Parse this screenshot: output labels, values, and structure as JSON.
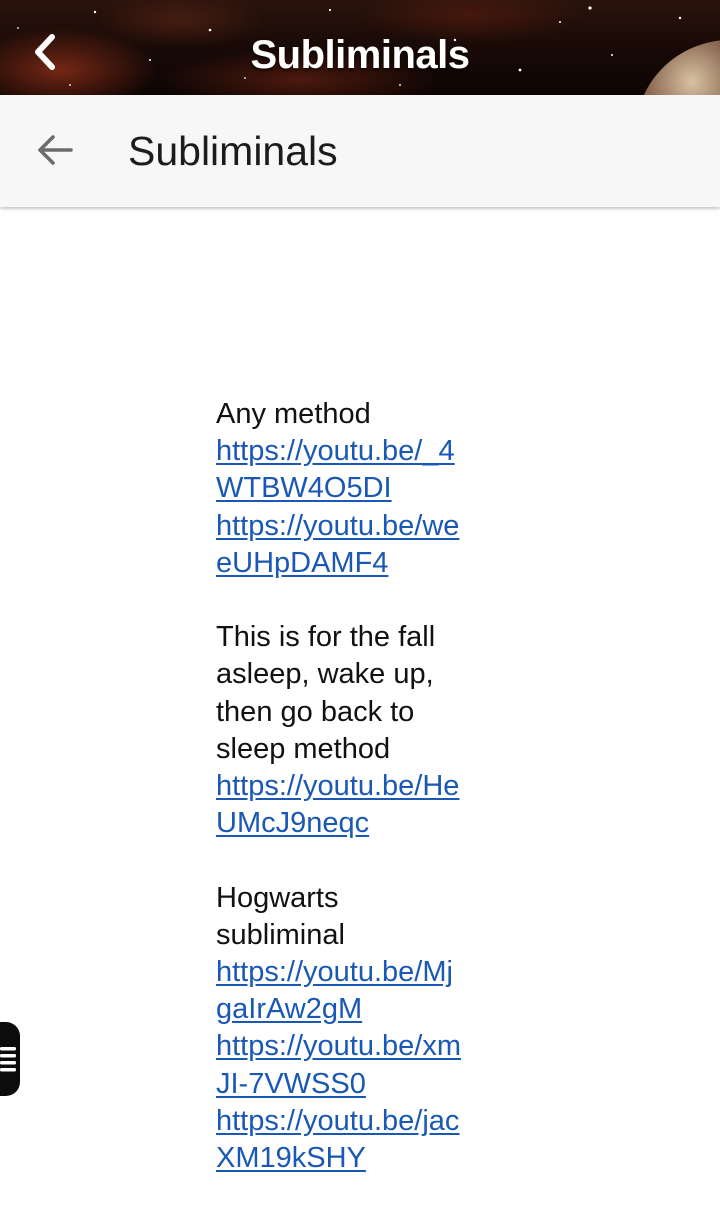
{
  "banner": {
    "title": "Subliminals",
    "back_icon": "chevron-left-icon"
  },
  "appbar": {
    "title": "Subliminals",
    "back_icon": "arrow-left-icon"
  },
  "post": {
    "section_1": {
      "text": "Any method",
      "links": [
        [
          "https://youtu.be/_4",
          "WTBW4O5DI"
        ],
        [
          "https://youtu.be/we",
          "eUHpDAMF4"
        ]
      ]
    },
    "section_2": {
      "text": [
        "This is for the fall",
        "asleep, wake up,",
        "then go back to",
        "sleep method"
      ],
      "links": [
        [
          "https://youtu.be/He",
          "UMcJ9neqc"
        ]
      ]
    },
    "section_3": {
      "text": [
        "Hogwarts",
        "subliminal"
      ],
      "links": [
        [
          "https://youtu.be/Mj",
          "gaIrAw2gM"
        ],
        [
          "https://youtu.be/xm",
          "JI-7VWSS0"
        ],
        [
          "https://youtu.be/jac",
          "XM19kSHY"
        ]
      ]
    }
  },
  "side_handle": {
    "icon": "list-menu-icon"
  },
  "colors": {
    "link": "#1a58b5",
    "appbar_bg": "#f7f7f7",
    "banner_text": "#ffffff"
  }
}
